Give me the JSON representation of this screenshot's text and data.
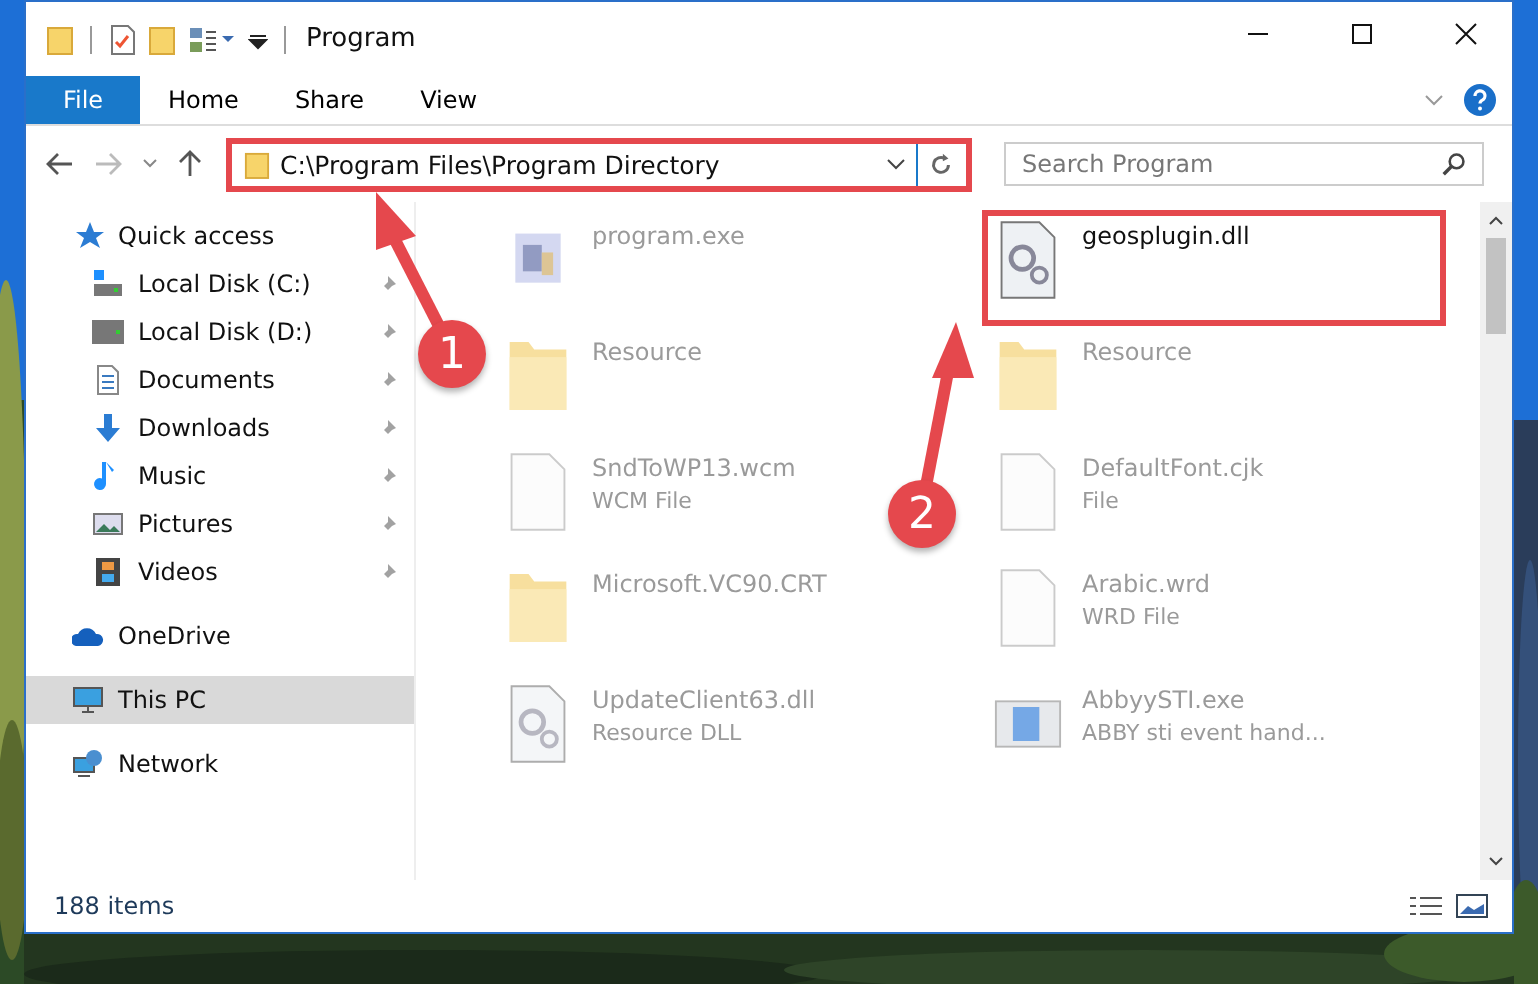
{
  "window": {
    "title": "Program"
  },
  "ribbon": {
    "file_button": "File",
    "tabs": [
      {
        "label": "Home",
        "kind": "tab",
        "selected": false
      },
      {
        "label": "Share",
        "kind": "tab",
        "selected": false
      },
      {
        "label": "View",
        "kind": "tab",
        "selected": false
      }
    ]
  },
  "address_bar": {
    "path": "C:\\Program Files\\Program Directory",
    "highlighted": true
  },
  "search": {
    "placeholder": "Search Program"
  },
  "sidebar": {
    "items": [
      {
        "label": "Quick access",
        "kind": "star",
        "selected": false,
        "pinned": false,
        "children": [
          {
            "label": "Local Disk (C:)",
            "kind": "drive-c",
            "selected": false,
            "pinned": true
          },
          {
            "label": "Local Disk (D:)",
            "kind": "drive",
            "selected": false,
            "pinned": true
          },
          {
            "label": "Documents",
            "kind": "documents",
            "selected": false,
            "pinned": true
          },
          {
            "label": "Downloads",
            "kind": "downloads",
            "selected": false,
            "pinned": true
          },
          {
            "label": "Music",
            "kind": "music",
            "selected": false,
            "pinned": true
          },
          {
            "label": "Pictures",
            "kind": "pictures",
            "selected": false,
            "pinned": true
          },
          {
            "label": "Videos",
            "kind": "videos",
            "selected": false,
            "pinned": true
          }
        ]
      },
      {
        "label": "OneDrive",
        "kind": "cloud",
        "selected": false,
        "pinned": false
      },
      {
        "label": "This PC",
        "kind": "pc",
        "selected": true,
        "pinned": false
      },
      {
        "label": "Network",
        "kind": "network",
        "selected": false,
        "pinned": false
      }
    ]
  },
  "files": [
    {
      "name": "program.exe",
      "kind": "exe",
      "blurred": true,
      "highlighted": false
    },
    {
      "name": "geosplugin.dll",
      "kind": "dll",
      "blurred": false,
      "highlighted": true
    },
    {
      "name": "Resource",
      "kind": "folder",
      "blurred": true,
      "highlighted": false
    },
    {
      "name": "Resource",
      "kind": "folder",
      "blurred": true,
      "highlighted": false
    },
    {
      "name": "SndToWP13.wcm",
      "type": "WCM File",
      "kind": "file",
      "blurred": true,
      "highlighted": false
    },
    {
      "name": "DefaultFont.cjk",
      "type": "File",
      "kind": "file",
      "blurred": true,
      "highlighted": false
    },
    {
      "name": "Microsoft.VC90.CRT",
      "kind": "folder",
      "blurred": true,
      "highlighted": false
    },
    {
      "name": "Arabic.wrd",
      "type": "WRD File",
      "kind": "file",
      "blurred": true,
      "highlighted": false
    },
    {
      "name": "UpdateClient63.dll",
      "type": "Resource DLL",
      "kind": "dll",
      "blurred": true,
      "highlighted": false
    },
    {
      "name": "AbbyySTI.exe",
      "type": "ABBY sti event hand...",
      "kind": "app",
      "blurred": true,
      "highlighted": false
    }
  ],
  "status_bar": {
    "item_count": "188 items"
  },
  "annotations": [
    {
      "number": "1"
    },
    {
      "number": "2"
    }
  ]
}
